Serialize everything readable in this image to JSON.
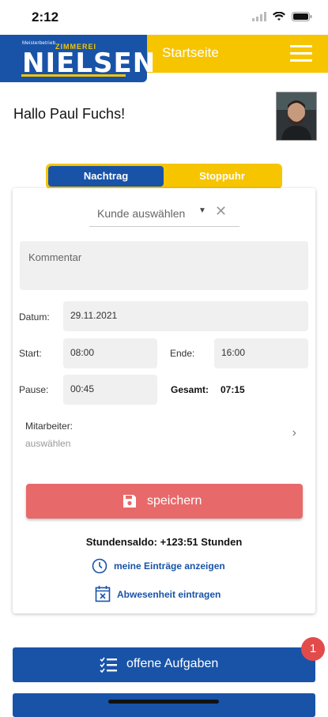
{
  "status_bar": {
    "time": "2:12"
  },
  "header": {
    "logo_small": "Meisterbetrieb",
    "logo_top": "ZIMMEREI",
    "logo_main": "NIELSEN",
    "title": "Startseite"
  },
  "greeting": "Hallo Paul Fuchs!",
  "tabs": {
    "active": "Nachtrag",
    "inactive": "Stoppuhr"
  },
  "form": {
    "customer_placeholder": "Kunde auswählen",
    "comment_placeholder": "Kommentar",
    "date_label": "Datum:",
    "date_value": "29.11.2021",
    "start_label": "Start:",
    "start_value": "08:00",
    "end_label": "Ende:",
    "end_value": "16:00",
    "pause_label": "Pause:",
    "pause_value": "00:45",
    "total_label": "Gesamt:",
    "total_value": "07:15",
    "employee_label": "Mitarbeiter:",
    "employee_value": "auswählen",
    "save_label": "speichern",
    "balance": "Stundensaldo: +123:51 Stunden",
    "link_entries": "meine Einträge anzeigen",
    "link_absence": "Abwesenheit eintragen"
  },
  "tasks": {
    "label": "offene Aufgaben",
    "badge": "1"
  },
  "colors": {
    "brand_blue": "#1853a8",
    "brand_yellow": "#f6c500",
    "save_red": "#e86969",
    "badge_red": "#e34b4b"
  }
}
